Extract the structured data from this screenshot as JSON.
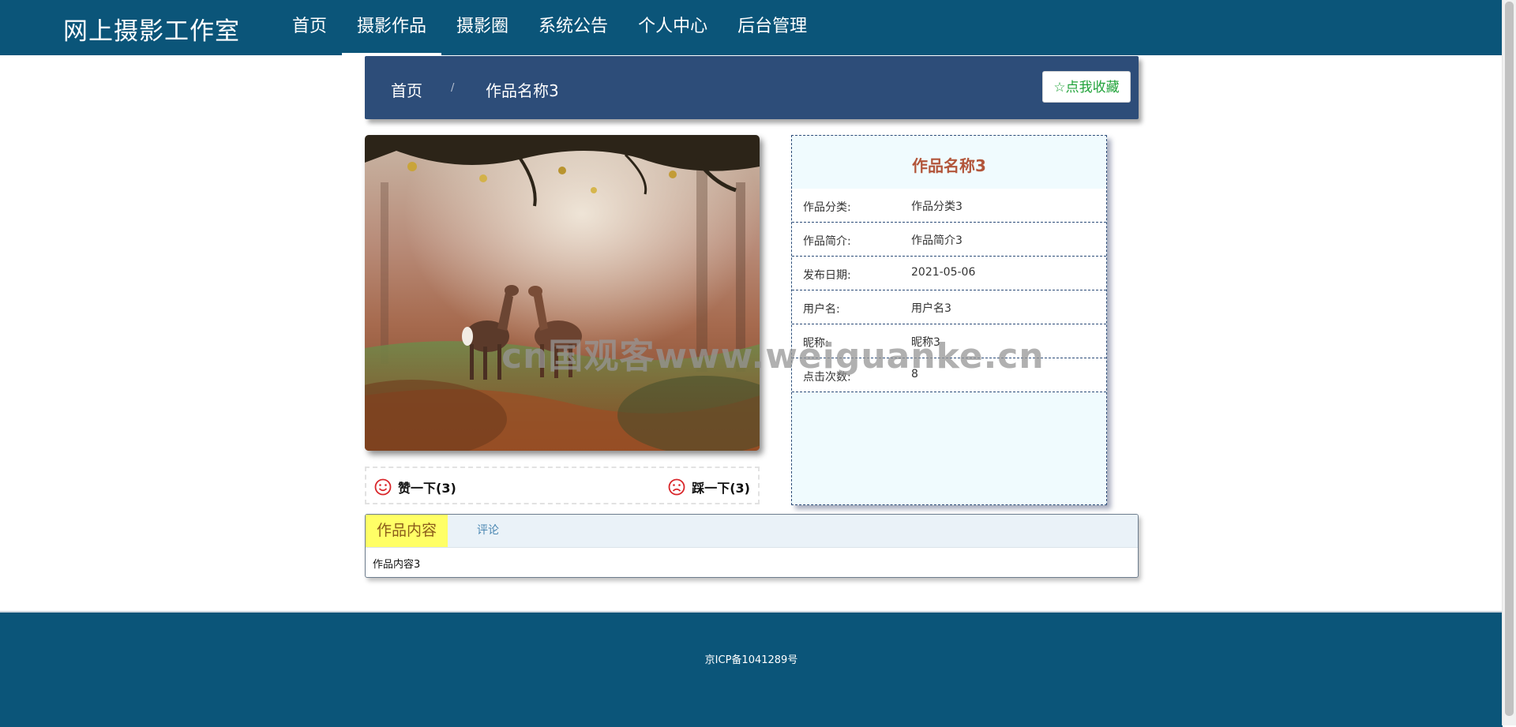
{
  "header": {
    "brand": "网上摄影工作室",
    "nav": [
      {
        "label": "首页",
        "active": false
      },
      {
        "label": "摄影作品",
        "active": true
      },
      {
        "label": "摄影圈",
        "active": false
      },
      {
        "label": "系统公告",
        "active": false
      },
      {
        "label": "个人中心",
        "active": false
      },
      {
        "label": "后台管理",
        "active": false
      }
    ]
  },
  "breadcrumb": {
    "home": "首页",
    "separator": "/",
    "current": "作品名称3",
    "favorite_label": "点我收藏",
    "favorite_icon": "star-outline-icon"
  },
  "work": {
    "title": "作品名称3",
    "fields": [
      {
        "key": "作品分类:",
        "value": "作品分类3"
      },
      {
        "key": "作品简介:",
        "value": "作品简介3"
      },
      {
        "key": "发布日期:",
        "value": "2021-05-06"
      },
      {
        "key": "用户名:",
        "value": "用户名3"
      },
      {
        "key": "昵称:",
        "value": "昵称3"
      },
      {
        "key": "点击次数:",
        "value": "8"
      }
    ]
  },
  "votes": {
    "like_label": "赞一下(3)",
    "dislike_label": "踩一下(3)",
    "like_icon": "smile-icon",
    "dislike_icon": "frown-icon"
  },
  "tabs": {
    "content_tab": "作品内容",
    "comment_tab": "评论",
    "content_body": "作品内容3"
  },
  "watermark": "cn国观客www.weiguanke.cn",
  "footer": {
    "icp": "京ICP备1041289号"
  },
  "colors": {
    "header_bg": "#0b5579",
    "breadcrumb_bg": "#2d4d79",
    "title_color": "#b2553a",
    "favorite_color": "#21a33a",
    "active_tab_bg": "#ffff66"
  }
}
